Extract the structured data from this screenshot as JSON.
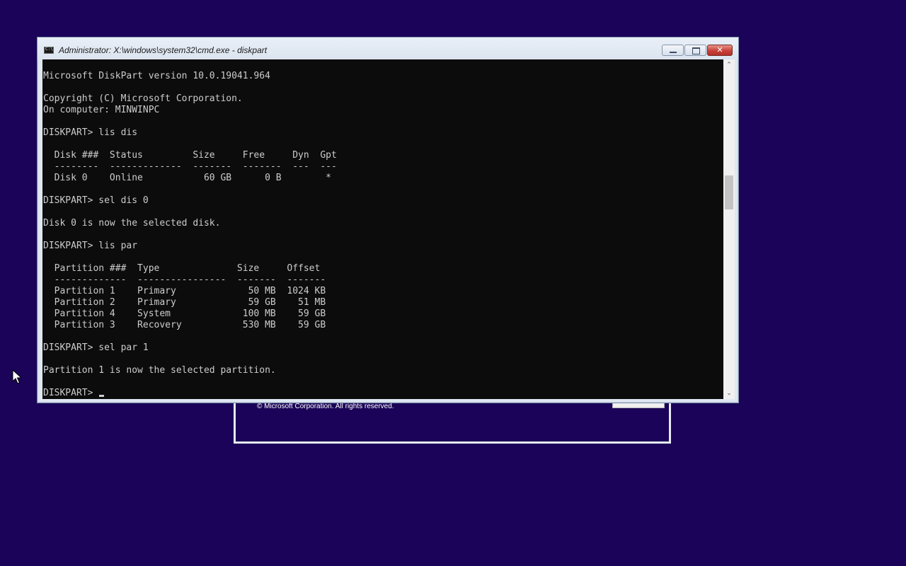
{
  "colors": {
    "desktop_background": "#1a0358",
    "console_background": "#0c0c0c",
    "console_text": "#cccccc",
    "title_bar": "#dfe7f1",
    "close_button": "#c8413a"
  },
  "setup_dialog": {
    "copyright": "© Microsoft Corporation. All rights reserved."
  },
  "window": {
    "title": "Administrator: X:\\windows\\system32\\cmd.exe - diskpart",
    "icon": "cmd-console-icon",
    "icon_text": "C:\\",
    "controls": {
      "minimize": "minimize-icon",
      "maximize": "maximize-icon",
      "close_glyph": "✕"
    }
  },
  "console": {
    "lines": [
      "Microsoft DiskPart version 10.0.19041.964",
      "",
      "Copyright (C) Microsoft Corporation.",
      "On computer: MINWINPC",
      "",
      "DISKPART> lis dis",
      "",
      "  Disk ###  Status         Size     Free     Dyn  Gpt",
      "  --------  -------------  -------  -------  ---  ---",
      "  Disk 0    Online           60 GB      0 B        *",
      "",
      "DISKPART> sel dis 0",
      "",
      "Disk 0 is now the selected disk.",
      "",
      "DISKPART> lis par",
      "",
      "  Partition ###  Type              Size     Offset",
      "  -------------  ----------------  -------  -------",
      "  Partition 1    Primary             50 MB  1024 KB",
      "  Partition 2    Primary             59 GB    51 MB",
      "  Partition 4    System             100 MB    59 GB",
      "  Partition 3    Recovery           530 MB    59 GB",
      "",
      "DISKPART> sel par 1",
      "",
      "Partition 1 is now the selected partition.",
      ""
    ],
    "prompt": "DISKPART> "
  },
  "scrollbar": {
    "up_glyph": "⌃",
    "down_glyph": "⌄"
  },
  "mouse_pointer_icon": "mouse-pointer-icon"
}
